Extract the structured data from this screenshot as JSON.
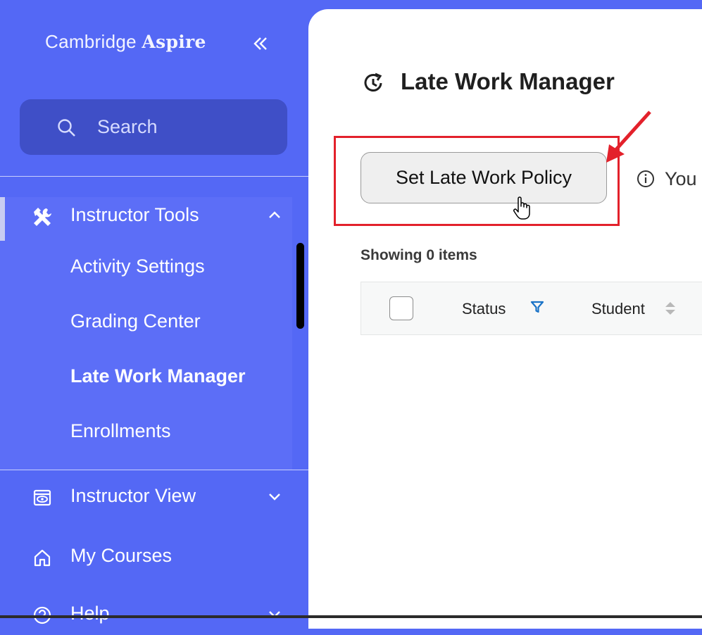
{
  "brand": {
    "name_light": "Cambridge",
    "name_bold": "Aspire"
  },
  "sidebar": {
    "search_label": "Search",
    "instructor_tools": {
      "label": "Instructor Tools",
      "items": [
        {
          "label": "Activity Settings",
          "active": false
        },
        {
          "label": "Grading Center",
          "active": false
        },
        {
          "label": "Late Work Manager",
          "active": true
        },
        {
          "label": "Enrollments",
          "active": false
        }
      ]
    },
    "instructor_view": {
      "label": "Instructor View"
    },
    "my_courses": {
      "label": "My Courses"
    },
    "help": {
      "label": "Help"
    }
  },
  "main": {
    "page_title": "Late Work Manager",
    "set_policy_button": "Set Late Work Policy",
    "info_text": "You c",
    "showing": "Showing 0 items",
    "table": {
      "columns": [
        "Status",
        "Student"
      ]
    }
  },
  "colors": {
    "sidebar_bg": "#5468f5",
    "highlight_red": "#e3212b",
    "filter_blue": "#1a73c7"
  },
  "icons": [
    "collapse-icon",
    "search-icon",
    "tools-icon",
    "chevron-up-icon",
    "instructor-view-icon",
    "chevron-down-icon",
    "home-icon",
    "help-icon",
    "history-icon",
    "info-icon",
    "filter-icon",
    "sort-icon",
    "hand-cursor-icon"
  ]
}
